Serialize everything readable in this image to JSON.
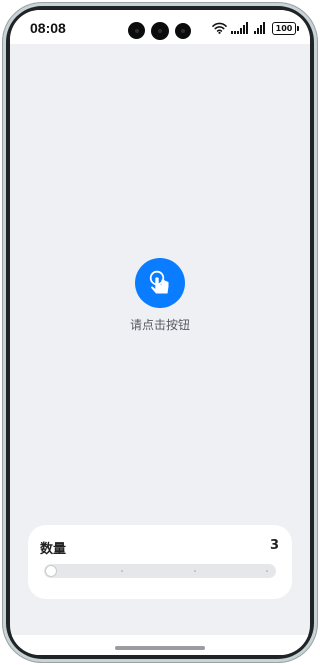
{
  "status_bar": {
    "time": "08:08",
    "battery": "100",
    "icons": [
      "wifi-icon",
      "signal-icon",
      "signal-icon",
      "battery-icon"
    ]
  },
  "main": {
    "button_icon": "tap-hand-icon",
    "button_label": "请点击按钮",
    "accent_color": "#0a7cff"
  },
  "card": {
    "title": "数量",
    "value": "3",
    "slider_value": 0,
    "slider_steps": 3
  }
}
